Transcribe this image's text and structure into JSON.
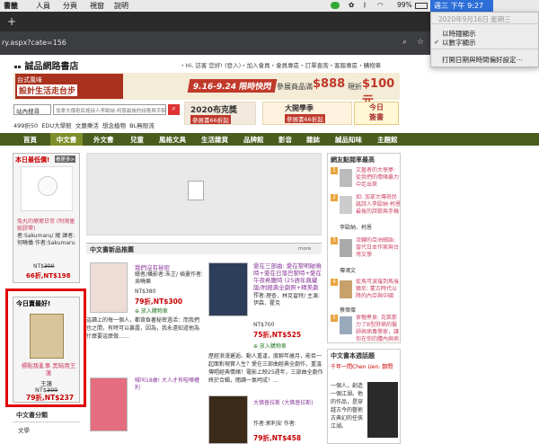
{
  "menubar": {
    "apple": "",
    "items": [
      "書籤",
      "人員",
      "分頁",
      "視窗",
      "說明"
    ],
    "status": {
      "battery": "99%",
      "bt": "",
      "wifi": ""
    },
    "clock": "週三 下午 9:27"
  },
  "clock_menu": {
    "date": "2020年9月16日 星期三",
    "option1": "以時鐘顯示",
    "option2": "以數字顯示",
    "option3": "打開日期與時間偏好設定⋯",
    "checked": "✓"
  },
  "tab": {
    "plus": "+"
  },
  "url": {
    "text": "ry.aspx?cate=156"
  },
  "site": {
    "logo": "誠品網路書店",
    "toplinks": "・Hi, 訪客 您好! (登入)・加入會員・會員專區・訂單查詢・客服專區・購物車",
    "banner1": {
      "left_title": "台式風味",
      "left_sub": "設計生活走台步",
      "date": "9.16-9.24 限時快閃",
      "middle": "參展商品滿",
      "amount": "$888",
      "cash": "現折",
      "cash_amount": "$100元"
    },
    "search": {
      "scope": "站內搜尋",
      "placeholder": "加拿大傳奇民謠詩人李歐納‧柯恩最後的詩歌與手稿"
    },
    "banner2": {
      "text": "2020布克獎",
      "sub": "參展書66折起",
      "daily": "今日",
      "daily2": "簽書",
      "exam": "大開學季",
      "exam_sub": "參展書66折起"
    },
    "quick": [
      "499折50",
      "EDU大學館",
      "文藝樂活",
      "想念植物",
      "BL無限流"
    ],
    "nav": [
      "首頁",
      "中文書",
      "外文書",
      "兒童",
      "風格文具",
      "生活雜貨",
      "品牌館",
      "影音",
      "雜誌",
      "誠品知味",
      "主題館"
    ],
    "nav_active": "中文書",
    "today": {
      "header": "本日最低價!",
      "badge": "看更多>",
      "title": "兔丸的療癒日常 (附限量紙膠帶)",
      "author": "繪者/攝影",
      "author2": "者:Sakumaru/ 繪 譯者:何曉儀 作者:Sakumaru",
      "orig_label": "NT$",
      "orig": "300",
      "disc": "66折,",
      "price": "NT$198"
    },
    "today_best": {
      "header": "今日賣最好!",
      "title": "標點叛亂事 黑暗用王蓮",
      "author": "王蓮",
      "orig_label": "NT$",
      "orig": "300",
      "disc": "79折,",
      "price": "NT$237"
    },
    "cat_sidebar": {
      "header": "中文書分類",
      "item": "文學"
    },
    "newbooks": {
      "header": "中文書新品推薦",
      "more": "more"
    },
    "books": [
      {
        "title": "我們沒有祕密",
        "author": "繪者/攝影者:朱芷/ 插畫作者:吳曉樂",
        "orig": "NT$380",
        "disc": "79折,",
        "price": "NT$300",
        "desc": "這讀上的每一個人，都背負著秘密過活：而我們也之間，有時可以暴露，因為，我永遠知道他為什麼要這麼做……"
      },
      {
        "title": "愛在三部曲: 愛在黎明破曉時+愛在日落巴黎時+愛在午夜希臘時 (25週年典藏版/附經典全劇照+精美劇照)",
        "author": "作者:理查．林克雷特/ 主演:伊森．霍克",
        "orig": "NT$700",
        "disc": "75折,",
        "price": "NT$525",
        "desc": "歷經浪漫邂逅、動人重逢，度聊年歲月，能否一起面對現實人生？愛在三部曲經典全劇作，重溫傳唱經典情緒！電影上映25週年，三部曲全劇作終於合輯，閱讀一氣呵成！..."
      },
      {
        "title": "喊叫18歲! 大人才有喧嘩權利",
        "author": "作者:",
        "orig": "",
        "disc": "",
        "price": "",
        "desc": ""
      },
      {
        "title": "大佛普拉斯 (大佛普拉斯)",
        "author": "作者:郭利安 作者:",
        "orig": "NT$580",
        "disc": "79折,",
        "price": "NT$458",
        "desc": ""
      }
    ],
    "ranking": {
      "header": "網友點閱率最高",
      "items": [
        {
          "n": "1",
          "title": "文藝者的大學夢: 從我們的情緒暴力中走出來",
          "author": ""
        },
        {
          "n": "2",
          "title": "如: 加拿大傳奇民謠詩人李歐納‧柯恩最後的詩歌與手稿",
          "author": "李歐納．柯恩"
        },
        {
          "n": "3",
          "title": "流轉的亞洲細語: 當代日本作家與台灣文學",
          "author": "傳鴻文"
        },
        {
          "n": "4",
          "title": "從馬可波羅到馬戛爾尼: 蒙古時代以降的內亞與中國",
          "author": "蔡偉傑"
        },
        {
          "n": "5",
          "title": "食糧煮食: 克萊那力了B型肝病的醫師與病毒學家，讓你在你的體內與病毒共存",
          "author": "嚴豐漢"
        }
      ]
    },
    "weekly": {
      "header": "中文書本週話題",
      "line1": "千年一問Chen Uen: 鄭問",
      "line2": "一個人，創造一個江湖。他的作品，是穿越古今的藝術古典幻的任俠江湖。"
    }
  },
  "highlight": {
    "color": "#e00000"
  }
}
